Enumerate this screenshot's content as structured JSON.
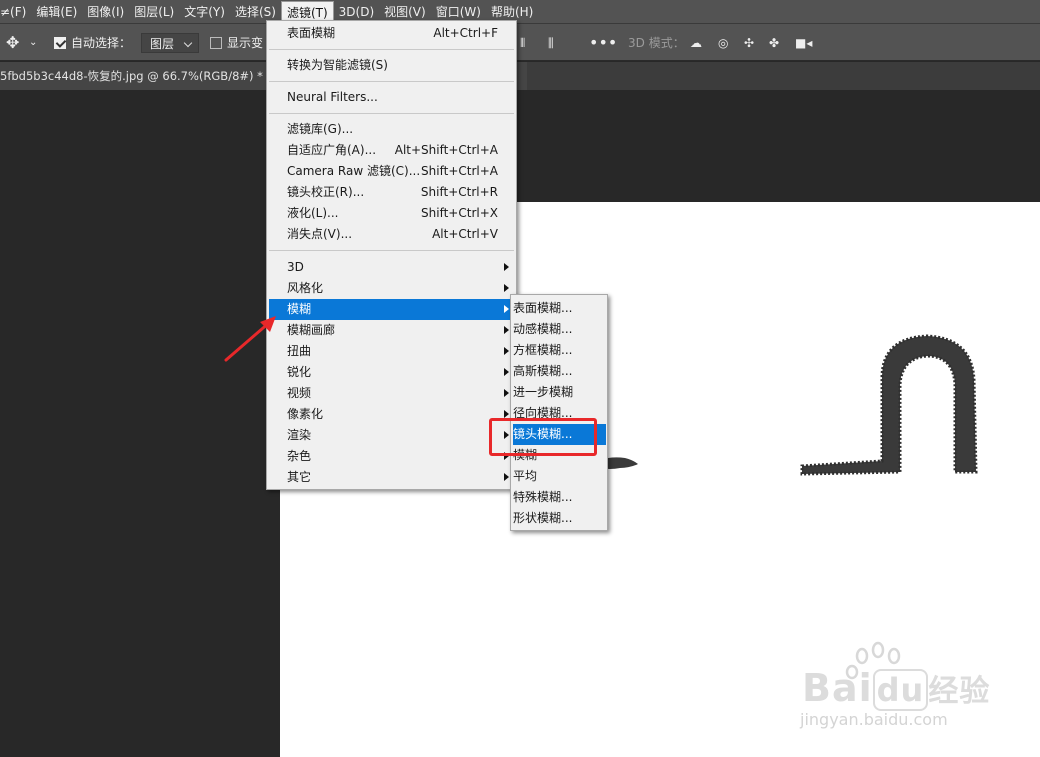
{
  "menubar": {
    "items": [
      "≠(F)",
      "编辑(E)",
      "图像(I)",
      "图层(L)",
      "文字(Y)",
      "选择(S)",
      "滤镜(T)",
      "3D(D)",
      "视图(V)",
      "窗口(W)",
      "帮助(H)"
    ],
    "active_index": 6
  },
  "options": {
    "auto_select_label": "自动选择：",
    "layer_dropdown": "图层",
    "show_transform_label": "显示变",
    "mode_3d_label": "3D 模式："
  },
  "document": {
    "tab_title": "5fbd5b3c44d8-恢复的.jpg @ 66.7%(RGB/8#) *"
  },
  "filter_menu": {
    "items": [
      {
        "label": "表面模糊",
        "shortcut": "Alt+Ctrl+F"
      },
      {
        "label": "转换为智能滤镜(S)",
        "shortcut": ""
      },
      {
        "label": "Neural Filters...",
        "shortcut": ""
      },
      {
        "label": "滤镜库(G)...",
        "shortcut": ""
      },
      {
        "label": "自适应广角(A)...",
        "shortcut": "Alt+Shift+Ctrl+A"
      },
      {
        "label": "Camera Raw 滤镜(C)...",
        "shortcut": "Shift+Ctrl+A"
      },
      {
        "label": "镜头校正(R)...",
        "shortcut": "Shift+Ctrl+R"
      },
      {
        "label": "液化(L)...",
        "shortcut": "Shift+Ctrl+X"
      },
      {
        "label": "消失点(V)...",
        "shortcut": "Alt+Ctrl+V"
      },
      {
        "label": "3D",
        "shortcut": ""
      },
      {
        "label": "风格化",
        "shortcut": ""
      },
      {
        "label": "模糊",
        "shortcut": ""
      },
      {
        "label": "模糊画廊",
        "shortcut": ""
      },
      {
        "label": "扭曲",
        "shortcut": ""
      },
      {
        "label": "锐化",
        "shortcut": ""
      },
      {
        "label": "视频",
        "shortcut": ""
      },
      {
        "label": "像素化",
        "shortcut": ""
      },
      {
        "label": "渲染",
        "shortcut": ""
      },
      {
        "label": "杂色",
        "shortcut": ""
      },
      {
        "label": "其它",
        "shortcut": ""
      }
    ]
  },
  "blur_submenu": {
    "items": [
      "表面模糊...",
      "动感模糊...",
      "方框模糊...",
      "高斯模糊...",
      "进一步模糊",
      "径向模糊...",
      "镜头模糊...",
      "模糊",
      "平均",
      "特殊模糊...",
      "形状模糊..."
    ]
  },
  "watermark": {
    "brand_a": "Bai",
    "brand_b": "du",
    "brand_c": "经验",
    "url": "jingyan.baidu.com"
  },
  "colors": {
    "highlight": "#0a78d7",
    "annotation_red": "#e8282a"
  }
}
